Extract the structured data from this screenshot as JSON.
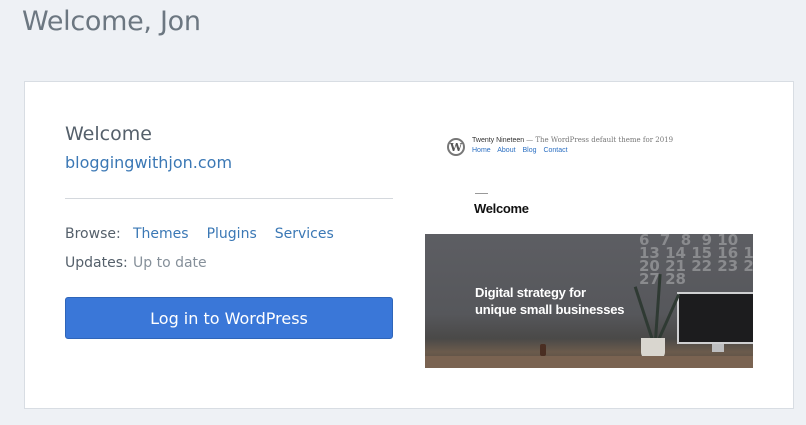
{
  "page": {
    "title": "Welcome, Jon"
  },
  "site": {
    "label": "Welcome",
    "url": "bloggingwithjon.com"
  },
  "browse": {
    "label": "Browse:",
    "links": [
      "Themes",
      "Plugins",
      "Services"
    ]
  },
  "updates": {
    "label": "Updates:",
    "status": "Up to date"
  },
  "login_button": {
    "label": "Log in to WordPress"
  },
  "preview": {
    "site_name": "Twenty Nineteen",
    "tagline": "— The WordPress default theme for 2019",
    "nav": [
      "Home",
      "About",
      "Blog",
      "Contact"
    ],
    "heading": "Welcome",
    "hero_line1": "Digital strategy for",
    "hero_line2": "unique small businesses",
    "calendar_digits": "6  7  8  9 10\n13 14 15 16 17\n20 21 22 23 24\n27 28"
  },
  "colors": {
    "accent": "#3a77d8",
    "link": "#3b78b5",
    "background": "#eef1f5"
  }
}
